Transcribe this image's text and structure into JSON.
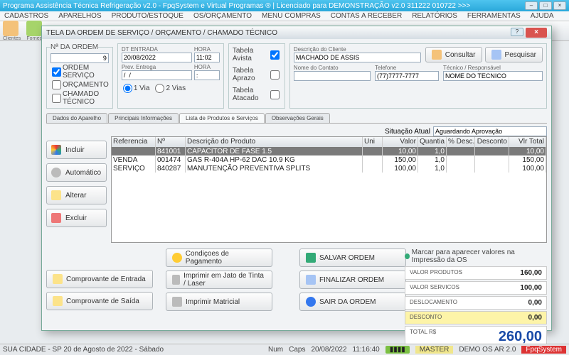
{
  "app_title": "Programa Assistência Técnica Refrigeração v2.0 - FpqSystem e Virtual Programas ® | Licenciado para DEMONSTRAÇÃO v2.0 311222 010722 >>>",
  "menu": [
    "CADASTROS",
    "APARELHOS",
    "PRODUTO/ESTOQUE",
    "OS/ORÇAMENTO",
    "MENU COMPRAS",
    "CONTAS A RECEBER",
    "RELATÓRIOS",
    "FERRAMENTAS",
    "AJUDA"
  ],
  "toolbar_labels": [
    "Clientes",
    "Fornec"
  ],
  "dialog_title": "TELA DA ORDEM DE SERVIÇO / ORÇAMENTO / CHAMADO TÉCNICO",
  "ordem": {
    "label": "Nª DA ORDEM",
    "value": "9"
  },
  "tipo": {
    "os": "ORDEM SERVIÇO",
    "orc": "ORÇAMENTO",
    "ch": "CHAMADO TÉCNICO"
  },
  "entrada": {
    "dt_label": "DT ENTRADA",
    "hora_label": "HORA",
    "dt": "20/08/2022",
    "hora": "11:02",
    "prev_label": "Prev. Entrega",
    "prev_hora_label": "HORA",
    "prev_dt": "/  /",
    "prev_hora": ":",
    "via_opt1": "1 Via",
    "via_opt2": "2 Vias"
  },
  "tabela": {
    "avista": "Tabela Avista",
    "aprazo": "Tabela Aprazo",
    "atacado": "Tabela Atacado"
  },
  "cliente": {
    "desc_label": "Descrição do Cliente",
    "desc": "MACHADO DE ASSIS",
    "contato_label": "Nome do Contato",
    "contato": "",
    "tel_label": "Telefone",
    "tel": "(77)7777-7777",
    "tec_label": "Técnico / Responsável",
    "tec": "NOME DO TECNICO"
  },
  "botoes_topo": {
    "consultar": "Consultar",
    "pesquisar": "Pesquisar"
  },
  "tabs": [
    "Dados do Aparelho",
    "Principais Informações",
    "Lista de Produtos e Serviços",
    "Observações Gerais"
  ],
  "situacao": {
    "label": "Situação Atual",
    "value": "Aguardando Aprovação"
  },
  "sidebtns": {
    "incluir": "Incluir",
    "auto": "Automático",
    "alterar": "Alterar",
    "excluir": "Excluir"
  },
  "grid": {
    "headers": [
      "Referencia",
      "Nº",
      "Descrição do Produto",
      "Uni",
      "Valor",
      "Quantia",
      "% Desc.",
      "Desconto",
      "Vlr Total"
    ],
    "rows": [
      {
        "ref": "",
        "nr": "841001",
        "desc": "CAPACITOR DE FASE 1.5",
        "uni": "",
        "val": "10,00",
        "q": "1,0",
        "pd": "",
        "d": "",
        "tot": "10,00",
        "sel": true
      },
      {
        "ref": "VENDA",
        "nr": "001474",
        "desc": "GAS R-404A HP-62 DAC 10.9 KG",
        "uni": "",
        "val": "150,00",
        "q": "1,0",
        "pd": "",
        "d": "",
        "tot": "150,00"
      },
      {
        "ref": "SERVIÇO",
        "nr": "840287",
        "desc": "MANUTENÇÃO PREVENTIVA SPLITS",
        "uni": "",
        "val": "100,00",
        "q": "1,0",
        "pd": "",
        "d": "",
        "tot": "100,00"
      }
    ]
  },
  "botoes_baixo": {
    "entrada": "Comprovante de Entrada",
    "saida": "Comprovante de Saída",
    "cond": "Condiçoes de Pagamento",
    "jato": "Imprimir em Jato de Tinta / Laser",
    "matricial": "Imprimir Matricial",
    "salvar": "SALVAR ORDEM",
    "finalizar": "FINALIZAR ORDEM",
    "sair": "SAIR DA ORDEM"
  },
  "marcar": "Marcar para aparecer valores na Impressão da OS",
  "totais": {
    "vp_label": "VALOR PRODUTOS",
    "vp": "160,00",
    "vs_label": "VALOR SERVICOS",
    "vs": "100,00",
    "dl_label": "DESLOCAMENTO",
    "dl": "0,00",
    "dc_label": "DESCONTO",
    "dc": "0,00",
    "tr_label": "TOTAL R$",
    "tr": "260,00"
  },
  "statusbar": {
    "loc": "SUA CIDADE - SP 20 de Agosto de 2022 - Sábado",
    "num": "Num",
    "caps": "Caps",
    "date": "20/08/2022",
    "time": "11:16:40",
    "master": "MASTER",
    "demo": "DEMO OS AR 2.0",
    "brand": "FpqSystem"
  }
}
